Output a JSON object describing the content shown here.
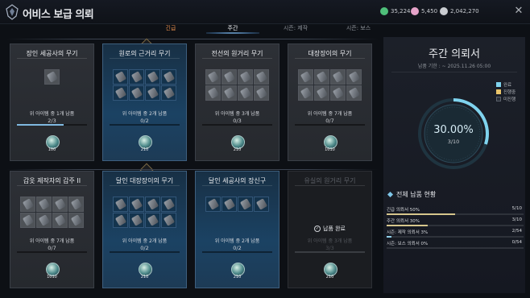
{
  "window": {
    "title": "어비스 보급 의뢰",
    "currencies": [
      {
        "icon": "green-coin-icon",
        "value": "35,224",
        "color": "#4fbf7a"
      },
      {
        "icon": "pink-crystal-icon",
        "value": "5,450",
        "color": "#e6a3c9"
      },
      {
        "icon": "silver-coin-icon",
        "value": "2,042,270",
        "color": "#c9ccd1"
      }
    ]
  },
  "tabs": [
    {
      "label": "긴급",
      "state": "urgent"
    },
    {
      "label": "주간",
      "state": "active"
    },
    {
      "label": "시즌: 제작",
      "state": "normal"
    },
    {
      "label": "시즌: 보스",
      "state": "normal"
    }
  ],
  "cards": [
    {
      "title": "장인 세공사의 무기",
      "style": "plain",
      "slots_total": 1,
      "slots_owned": 1,
      "desc": "위 아이템 중 1개 납품",
      "progress": "2/3",
      "progress_ratio": 0.667,
      "reward": "100"
    },
    {
      "title": "원로의 근거리 무기",
      "style": "blue",
      "slots_total": 8,
      "slots_owned": 8,
      "desc": "위 아이템 중 2개 납품",
      "progress": "0/2",
      "progress_ratio": 0,
      "reward": "210"
    },
    {
      "title": "전선의 원거리 무기",
      "style": "plain",
      "slots_total": 8,
      "slots_owned": 8,
      "desc": "위 아이템 중 3개 납품",
      "progress": "0/3",
      "progress_ratio": 0,
      "reward": "210"
    },
    {
      "title": "대장장이의 무기",
      "style": "plain",
      "slots_total": 8,
      "slots_owned": 8,
      "desc": "위 아이템 중 7개 납품",
      "progress": "0/7",
      "progress_ratio": 0,
      "reward": "1010"
    },
    {
      "title": "갑옷 제작자의 갑주 II",
      "style": "plain",
      "slots_total": 8,
      "slots_owned": 8,
      "desc": "위 아이템 중 7개 납품",
      "progress": "0/7",
      "progress_ratio": 0,
      "reward": "1010"
    },
    {
      "title": "달인 대장장이의 무기",
      "style": "blue",
      "slots_total": 8,
      "slots_owned": 8,
      "desc": "위 아이템 중 2개 납품",
      "progress": "0/2",
      "progress_ratio": 0,
      "reward": "210"
    },
    {
      "title": "달인 세공사의 장신구",
      "style": "blue",
      "slots_total": 4,
      "slots_owned": 4,
      "desc": "위 아이템 중 2개 납품",
      "progress": "0/2",
      "progress_ratio": 0,
      "reward": "210"
    },
    {
      "title": "유실의 원거리 무기",
      "style": "done",
      "slots_total": 0,
      "slots_owned": 0,
      "desc": "위 아이템 중 3개 납품",
      "progress": "3/3",
      "progress_ratio": 1,
      "reward": "210",
      "done_label": "납품 완료"
    }
  ],
  "panel": {
    "title": "주간 의뢰서",
    "deadline": "납품 기한 : ~ 2025.11.26 05:00",
    "legend": [
      {
        "label": "완료",
        "color": "#7fd3ee"
      },
      {
        "label": "진행중",
        "color": "#e9c46a"
      },
      {
        "label": "미진행",
        "color": "#2a2f38"
      }
    ],
    "ring_percent": "30.00%",
    "ring_count": "3/10",
    "ring_value": 0.3,
    "status_title": "전체 납품 현황",
    "status": [
      {
        "label": "긴급 의뢰서 50%",
        "count": "5/10",
        "ratio": 0.5,
        "color": "#d6c68c"
      },
      {
        "label": "주간 의뢰서 30%",
        "count": "3/10",
        "ratio": 0.3,
        "color": "#d6c68c"
      },
      {
        "label": "시즌: 제작 의뢰서 3%",
        "count": "2/54",
        "ratio": 0.037,
        "color": "#8fd0ea"
      },
      {
        "label": "시즌: 보스 의뢰서 0%",
        "count": "0/54",
        "ratio": 0,
        "color": "#8fd0ea"
      }
    ]
  }
}
